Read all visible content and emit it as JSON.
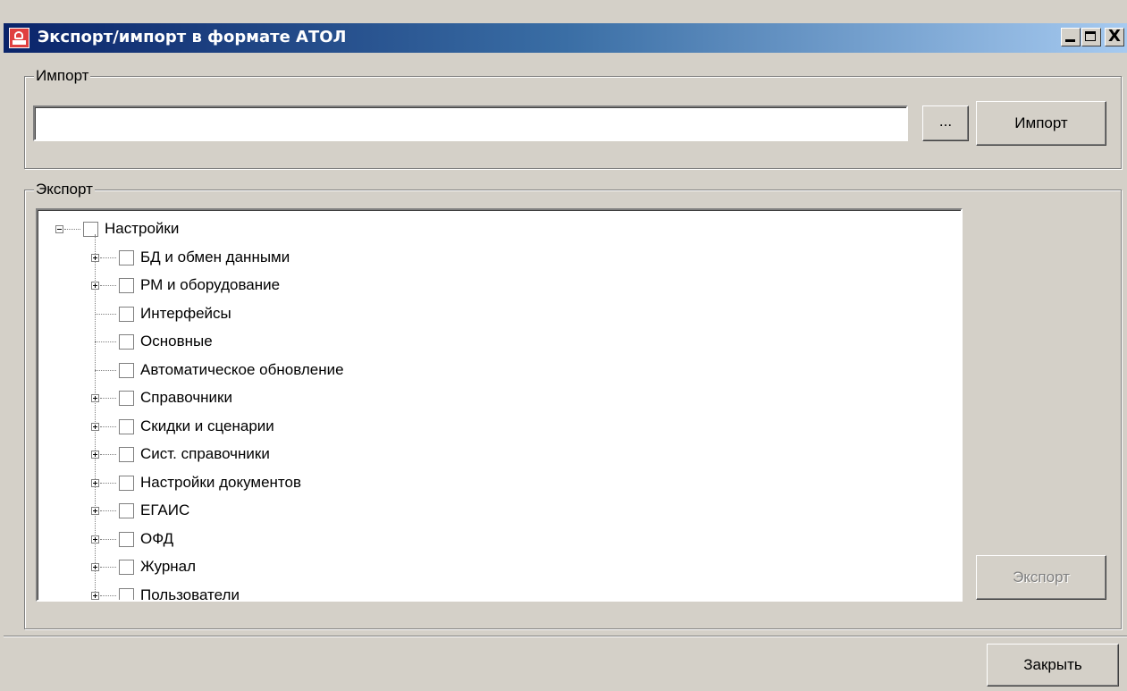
{
  "window": {
    "title": "Экспорт/импорт в формате АТОЛ",
    "close_glyph": "X"
  },
  "import_group": {
    "label": "Импорт",
    "path_value": "",
    "browse_label": "...",
    "import_button": "Импорт"
  },
  "export_group": {
    "label": "Экспорт",
    "export_button": "Экспорт"
  },
  "tree": {
    "root": {
      "label": "Настройки",
      "expanded": true,
      "checked": false
    },
    "children": [
      {
        "label": "БД и обмен данными",
        "expandable": true,
        "checked": false
      },
      {
        "label": "РМ и оборудование",
        "expandable": true,
        "checked": false
      },
      {
        "label": "Интерфейсы",
        "expandable": false,
        "checked": false
      },
      {
        "label": "Основные",
        "expandable": false,
        "checked": false
      },
      {
        "label": "Автоматическое обновление",
        "expandable": false,
        "checked": false
      },
      {
        "label": "Справочники",
        "expandable": true,
        "checked": false
      },
      {
        "label": "Скидки и сценарии",
        "expandable": true,
        "checked": false
      },
      {
        "label": "Сист. справочники",
        "expandable": true,
        "checked": false
      },
      {
        "label": "Настройки документов",
        "expandable": true,
        "checked": false
      },
      {
        "label": "ЕГАИС",
        "expandable": true,
        "checked": false
      },
      {
        "label": "ОФД",
        "expandable": true,
        "checked": false
      },
      {
        "label": "Журнал",
        "expandable": true,
        "checked": false
      },
      {
        "label": "Пользователи",
        "expandable": true,
        "checked": false
      }
    ]
  },
  "footer": {
    "close_button": "Закрыть"
  },
  "colors": {
    "title_gradient_start": "#0a246a",
    "title_gradient_end": "#a6caf0",
    "window_bg": "#d4d0c8",
    "disabled_text": "#808080"
  }
}
